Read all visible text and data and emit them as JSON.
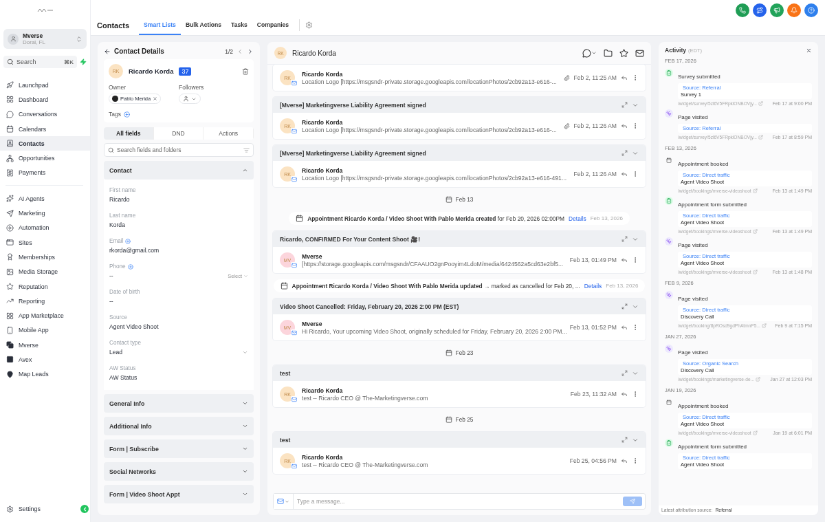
{
  "sidebar": {
    "account": {
      "name": "Mverse",
      "location": "Doral, FL"
    },
    "search": {
      "placeholder": "Search",
      "shortcut": "⌘K"
    },
    "primary": [
      {
        "label": "Launchpad",
        "selected": false
      },
      {
        "label": "Dashboard",
        "selected": false
      },
      {
        "label": "Conversations",
        "selected": false
      },
      {
        "label": "Calendars",
        "selected": false
      },
      {
        "label": "Contacts",
        "selected": true
      },
      {
        "label": "Opportunities",
        "selected": false
      },
      {
        "label": "Payments",
        "selected": false
      }
    ],
    "secondary": [
      {
        "label": "AI Agents",
        "selected": false
      },
      {
        "label": "Marketing",
        "selected": false
      },
      {
        "label": "Automation",
        "selected": false
      },
      {
        "label": "Sites",
        "selected": false
      },
      {
        "label": "Memberships",
        "selected": false
      },
      {
        "label": "Media Storage",
        "selected": false
      },
      {
        "label": "Reputation",
        "selected": false
      },
      {
        "label": "Reporting",
        "selected": false
      },
      {
        "label": "App Marketplace",
        "selected": false
      },
      {
        "label": "Mobile App",
        "selected": false
      },
      {
        "label": "Mverse",
        "selected": false
      },
      {
        "label": "Avex",
        "selected": false
      },
      {
        "label": "Map Leads",
        "selected": false
      }
    ],
    "settings": {
      "label": "Settings",
      "selected": false
    }
  },
  "quick_actions": [
    {
      "color": "#1f9d55"
    },
    {
      "color": "#2563eb"
    },
    {
      "color": "#22a35a"
    },
    {
      "color": "#f97316"
    },
    {
      "color": "#2f80ed"
    }
  ],
  "header": {
    "title": "Contacts",
    "tabs": [
      {
        "label": "Smart Lists",
        "selected": true
      },
      {
        "label": "Bulk Actions",
        "selected": false
      },
      {
        "label": "Tasks",
        "selected": false
      },
      {
        "label": "Companies",
        "selected": false
      }
    ]
  },
  "contact_panel": {
    "title": "Contact Details",
    "pager": "1/2",
    "contact": {
      "initials": "RK",
      "name": "Ricardo Korda",
      "badge": "37"
    },
    "owner_label": "Owner",
    "owner": "Pablo Merida",
    "followers_label": "Followers",
    "tags_label": "Tags",
    "field_tabs": [
      {
        "label": "All fields",
        "selected": true
      },
      {
        "label": "DND",
        "selected": false
      },
      {
        "label": "Actions",
        "selected": false
      }
    ],
    "search_placeholder": "Search fields and folders",
    "sections": [
      {
        "title": "Contact",
        "expanded": true,
        "fields": [
          {
            "label": "First name",
            "value": "Ricardo",
            "kind": "text",
            "addable": false
          },
          {
            "label": "Last name",
            "value": "Korda",
            "kind": "text",
            "addable": false
          },
          {
            "label": "Email",
            "value": "rkorda@gmail.com",
            "kind": "text",
            "addable": true
          },
          {
            "label": "Phone",
            "value": "--",
            "kind": "phone",
            "addable": true,
            "select": "Select"
          },
          {
            "label": "Date of birth",
            "value": "--",
            "kind": "text",
            "addable": false
          },
          {
            "label": "Source",
            "value": "Agent Video Shoot",
            "kind": "text",
            "addable": false
          },
          {
            "label": "Contact type",
            "value": "Lead",
            "kind": "select",
            "addable": false
          },
          {
            "label": "AW Status",
            "value": "AW Status",
            "kind": "text",
            "addable": false
          }
        ]
      },
      {
        "title": "General Info",
        "expanded": false
      },
      {
        "title": "Additional Info",
        "expanded": false
      },
      {
        "title": "Form | Subscribe",
        "expanded": false
      },
      {
        "title": "Social Networks",
        "expanded": false
      },
      {
        "title": "Form | Video Shoot Appt",
        "expanded": false
      }
    ]
  },
  "conversation": {
    "contact": {
      "initials": "RK",
      "name": "Ricardo Korda"
    },
    "items": [
      {
        "kind": "email",
        "sender": "Ricardo Korda",
        "initials": "RK",
        "color": "#fbe3c2",
        "preview": "Location Logo [https://msgsndr-private.storage.googleapis.com/locationPhotos/2cb92a13-e616-...",
        "time": "Feb 2, 11:25 AM",
        "attachment": true
      },
      {
        "kind": "email",
        "subject": "[Mverse] Marketingverse Liability Agreement signed",
        "sender": "Ricardo Korda",
        "initials": "RK",
        "color": "#fbe3c2",
        "preview": "Location Logo [https://msgsndr-private.storage.googleapis.com/locationPhotos/2cb92a13-e616-...",
        "time": "Feb 2, 11:26 AM",
        "attachment": true
      },
      {
        "kind": "email",
        "subject": "[Mverse] Marketingverse Liability Agreement signed",
        "sender": "Ricardo Korda",
        "initials": "RK",
        "color": "#fbe3c2",
        "preview": "Location Logo [https://msgsndr-private.storage.googleapis.com/locationPhotos/2cb92a13-e616-491...",
        "time": "Feb 2, 11:26 AM",
        "attachment": false
      },
      {
        "kind": "date",
        "label": "Feb 13"
      },
      {
        "kind": "event",
        "text": "**Appointment Ricardo Korda / Video Shoot With Pablo Merida created** for Feb 20, 2026 02:00PM",
        "link": "Details",
        "date": "Feb 13, 2026"
      },
      {
        "kind": "email",
        "subject": "Ricardo, CONFIRMED For Your Content Shoot 🎥!",
        "sender": "Mverse",
        "initials": "MV",
        "color": "#fcd5dc",
        "preview": "[https://storage.googleapis.com/msgsndr/CFAAUO2gnPooyim4LdoM/media/6424562a5cd63e2bf5...",
        "time": "Feb 13, 01:49 PM",
        "attachment": false
      },
      {
        "kind": "event",
        "text": "**Appointment Ricardo Korda / Video Shoot With Pablo Merida updated** → marked as cancelled for Feb 20, ...",
        "link": "Details",
        "date": "Feb 13, 2026"
      },
      {
        "kind": "email",
        "subject": "Video Shoot Cancelled: Friday, February 20, 2026 2:00 PM (EST)",
        "sender": "Mverse",
        "initials": "MV",
        "color": "#fcd5dc",
        "preview": "Hi Ricardo, Your upcoming Video Shoot, originally scheduled for Friday, February 20, 2026 2:00 PM...",
        "time": "Feb 13, 01:52 PM",
        "attachment": false
      },
      {
        "kind": "date",
        "label": "Feb 23"
      },
      {
        "kind": "email",
        "subject": "test",
        "sender": "Ricardo Korda",
        "initials": "RK",
        "color": "#fbe3c2",
        "preview": "test -- Ricardo CEO @ The-Marketingverse.com",
        "time": "Feb 23, 11:32 AM",
        "attachment": false
      },
      {
        "kind": "date",
        "label": "Feb 25"
      },
      {
        "kind": "email",
        "subject": "test",
        "sender": "Ricardo Korda",
        "initials": "RK",
        "color": "#fbe3c2",
        "preview": "test  -- Ricardo CEO @ The-Marketingverse.com",
        "time": "Feb 25, 04:56 PM",
        "attachment": false
      }
    ],
    "composer_placeholder": "Type a message..."
  },
  "activity": {
    "title": "Activity",
    "timezone": "(EDT)",
    "groups": [
      {
        "date": "FEB 17, 2026",
        "entries": [
          {
            "kind": "survey",
            "title": "Survey submitted",
            "source": "Source: Referral",
            "detail": "Survey 1",
            "url": "/widget/survey/5zl6V5FRpklONBOVjy...",
            "time": "Feb 17 at 9:00 PM"
          },
          {
            "kind": "page",
            "title": "Page visited",
            "source": "Source: Referral",
            "url": "/widget/survey/5zl6V5FRpklONBOVjy...",
            "time": "Feb 17 at 8:59 PM"
          }
        ]
      },
      {
        "date": "FEB 13, 2026",
        "entries": [
          {
            "kind": "appointment",
            "title": "Appointment booked",
            "source": "Source: Direct traffic",
            "detail": "Agent Video Shoot",
            "url": "/widget/bookings/mverse-videoshoot",
            "time": "Feb 13 at 1:49 PM"
          },
          {
            "kind": "form",
            "title": "Appointment form submitted",
            "source": "Source: Direct traffic",
            "detail": "Agent Video Shoot",
            "url": "/widget/bookings/mverse-videoshoot",
            "time": "Feb 13 at 1:49 PM"
          },
          {
            "kind": "page",
            "title": "Page visited",
            "source": "Source: Direct traffic",
            "detail": "Agent Video Shoot",
            "url": "/widget/bookings/mverse-videoshoot",
            "time": "Feb 13 at 1:48 PM"
          }
        ]
      },
      {
        "date": "FEB 9, 2026",
        "entries": [
          {
            "kind": "page",
            "title": "Page visited",
            "source": "Source: Direct traffic",
            "detail": "Discovery Call",
            "url": "/widget/booking/8pROsd9gdPhAtmnP5...",
            "time": "Feb 9 at 7:15 PM"
          }
        ]
      },
      {
        "date": "JAN 27, 2026",
        "entries": [
          {
            "kind": "page",
            "title": "Page visited",
            "source": "Source: Organic Search",
            "detail": "Discovery Call",
            "url": "/widget/bookings/marketingverse-de...",
            "time": "Jan 27 at 12:03 PM"
          }
        ]
      },
      {
        "date": "JAN 19, 2026",
        "entries": [
          {
            "kind": "appointment",
            "title": "Appointment booked",
            "source": "Source: Direct traffic",
            "detail": "Agent Video Shoot",
            "url": "/widget/bookings/mverse-videoshoot",
            "time": "Jan 19 at 6:01 PM"
          },
          {
            "kind": "form",
            "title": "Appointment form submitted",
            "source": "Source: Direct traffic",
            "detail": "Agent Video Shoot"
          }
        ]
      }
    ],
    "footer_label": "Latest attribution source:",
    "footer_value": "Referral"
  }
}
